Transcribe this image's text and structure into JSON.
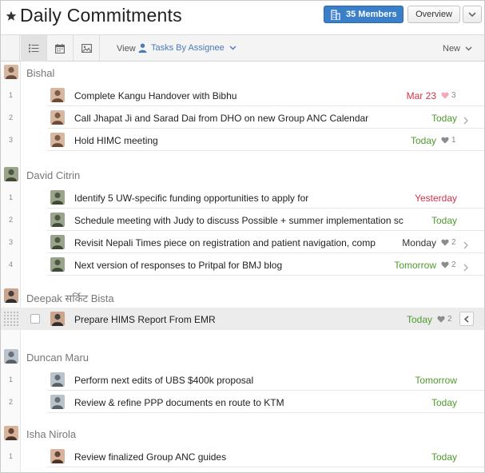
{
  "header": {
    "title": "Daily Commitments",
    "members_label": "35 Members",
    "overview_label": "Overview"
  },
  "toolbar": {
    "view_label": "View",
    "view_value": "Tasks By Assignee",
    "sort_value": "New"
  },
  "groups": [
    {
      "name": "Bishal",
      "tasks": [
        {
          "num": "1",
          "text": "Complete Kangu Handover with Bibhu",
          "due": "Mar 23",
          "due_color": "red",
          "hearts": "3",
          "heart_style": "pink",
          "arrow": false
        },
        {
          "num": "2",
          "text": "Call Jhapat Ji and Sarad Dai from DHO on new Group ANC Calendar",
          "due": "Today",
          "due_color": "green",
          "hearts": "",
          "arrow": true
        },
        {
          "num": "3",
          "text": "Hold HIMC meeting",
          "due": "Today",
          "due_color": "green",
          "hearts": "1",
          "heart_style": "gray",
          "arrow": false
        }
      ]
    },
    {
      "name": "David Citrin",
      "tasks": [
        {
          "num": "1",
          "text": "Identify 5 UW-specific funding opportunities to apply for",
          "due": "Yesterday",
          "due_color": "red",
          "hearts": "",
          "arrow": false
        },
        {
          "num": "2",
          "text": "Schedule meeting with Judy to discuss Possible + summer implementation sc",
          "due": "Today",
          "due_color": "green",
          "hearts": "",
          "arrow": false
        },
        {
          "num": "3",
          "text": "Revisit Nepali Times piece on registration and patient navigation, comp",
          "due": "Monday",
          "due_color": "dark",
          "hearts": "2",
          "heart_style": "gray",
          "arrow": true
        },
        {
          "num": "4",
          "text": "Next version of responses to Pritpal for BMJ blog",
          "due": "Tomorrow",
          "due_color": "green",
          "hearts": "2",
          "heart_style": "gray",
          "arrow": true
        }
      ]
    },
    {
      "name": "Deepak सर्किट Bista",
      "tasks": [
        {
          "num": "",
          "text": "Prepare HIMS Report From EMR",
          "due": "Today",
          "due_color": "green",
          "hearts": "2",
          "heart_style": "gray",
          "arrow": false,
          "selected": true
        }
      ]
    },
    {
      "name": "Duncan Maru",
      "tasks": [
        {
          "num": "1",
          "text": "Perform next edits of UBS $400k proposal",
          "due": "Tomorrow",
          "due_color": "green",
          "hearts": "",
          "arrow": false
        },
        {
          "num": "2",
          "text": "Review & refine PPP documents en route to KTM",
          "due": "Today",
          "due_color": "green",
          "hearts": "",
          "arrow": false
        }
      ]
    },
    {
      "name": "Isha Nirola",
      "tasks": [
        {
          "num": "1",
          "text": "Review finalized Group ANC guides",
          "due": "Today",
          "due_color": "green",
          "hearts": "",
          "arrow": false
        }
      ]
    }
  ],
  "colors": {
    "primary_button": "#3a7fc8",
    "due_red": "#d2334a",
    "due_green": "#4f9a2d",
    "link_blue": "#4a7ab8"
  }
}
